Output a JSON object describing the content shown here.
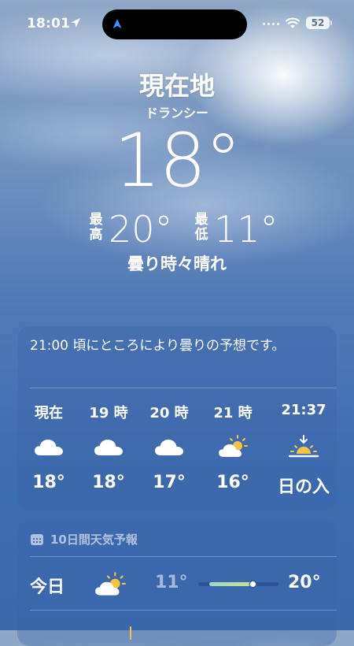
{
  "status_bar": {
    "time": "18:01",
    "battery": "52"
  },
  "header": {
    "location": "現在地",
    "sublocation": "ドランシー",
    "temperature": "18°",
    "high_label": "最高",
    "high": "20°",
    "low_label": "最低",
    "low": "11°",
    "condition": "曇り時々晴れ"
  },
  "hourly": {
    "summary": "21:00 頃にところにより曇りの予想です。",
    "items": [
      {
        "label": "現在",
        "icon": "cloud-icon",
        "temp": "18°"
      },
      {
        "label": "19 時",
        "icon": "cloud-icon",
        "temp": "18°"
      },
      {
        "label": "20 時",
        "icon": "cloud-icon",
        "temp": "17°"
      },
      {
        "label": "21 時",
        "icon": "partly-sunny-icon",
        "temp": "16°"
      },
      {
        "label": "21:37",
        "icon": "sunset-icon",
        "temp": "日の入"
      }
    ]
  },
  "daily": {
    "header": "10日間天気予報",
    "days": [
      {
        "label": "今日",
        "icon": "partly-sunny-icon",
        "low": "11°",
        "high": "20°",
        "range_start": 0.14,
        "range_end": 0.73,
        "current": 0.68
      }
    ]
  },
  "colors": {
    "range_start": "#9fd6c8",
    "range_end": "#c9e28a",
    "sun": "#f5c542",
    "card": "rgba(60,100,170,0.35)"
  }
}
